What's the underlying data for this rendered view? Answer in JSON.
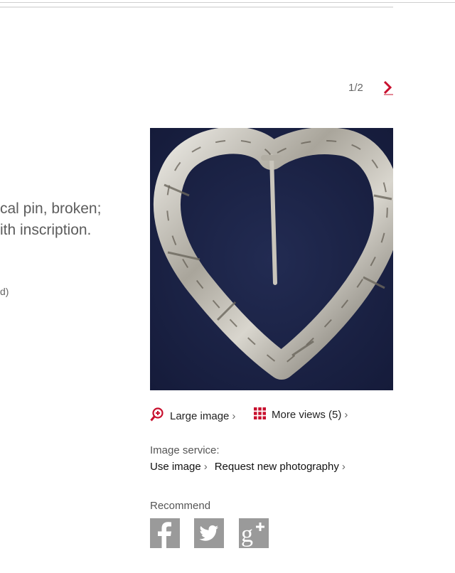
{
  "description": {
    "line1": "cal pin, broken;",
    "line2": "ith inscription.",
    "small": "d)"
  },
  "pager": {
    "text": "1/2",
    "next_icon": "chevron-right-icon",
    "accent": "#c8102e"
  },
  "image": {
    "subject": "heart-shaped silver brooch",
    "background": "#1c2447"
  },
  "image_links": {
    "large_image": "Large image",
    "large_image_icon": "zoom-plus-icon",
    "more_views": "More views (5)",
    "more_views_icon": "grid-icon"
  },
  "image_service": {
    "label": "Image service:",
    "use_image": "Use image",
    "request_photo": "Request new photography"
  },
  "recommend": {
    "label": "Recommend",
    "icons": [
      "facebook-icon",
      "twitter-icon",
      "google-plus-icon"
    ],
    "icon_color": "#9a9a9a"
  },
  "chevron": "›"
}
